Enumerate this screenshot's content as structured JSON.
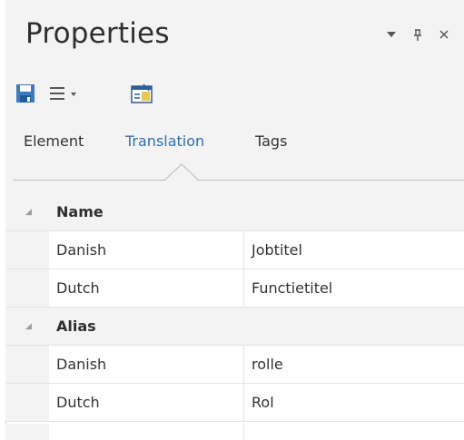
{
  "window": {
    "title": "Properties",
    "controls": {
      "menu_icon": "dropdown-triangle",
      "pin_icon": "pin",
      "close_icon": "close"
    }
  },
  "toolbar": {
    "items": [
      {
        "icon": "save-icon"
      },
      {
        "icon": "hamburger-menu-icon"
      },
      {
        "icon": "properties-window-icon"
      }
    ]
  },
  "tabs": [
    {
      "label": "Element",
      "active": false
    },
    {
      "label": "Translation",
      "active": true
    },
    {
      "label": "Tags",
      "active": false
    }
  ],
  "properties": {
    "categories": [
      {
        "label": "Name",
        "expanded": true,
        "rows": [
          {
            "name": "Danish",
            "value": "Jobtitel"
          },
          {
            "name": "Dutch",
            "value": "Functietitel"
          }
        ]
      },
      {
        "label": "Alias",
        "expanded": true,
        "rows": [
          {
            "name": "Danish",
            "value": "rolle"
          },
          {
            "name": "Dutch",
            "value": "Rol"
          }
        ]
      }
    ]
  },
  "colors": {
    "accent": "#2f6fb0",
    "panel_bg": "#f3f3f3",
    "grid_bg": "#ffffff",
    "icon_blue": "#3a7cc4"
  }
}
